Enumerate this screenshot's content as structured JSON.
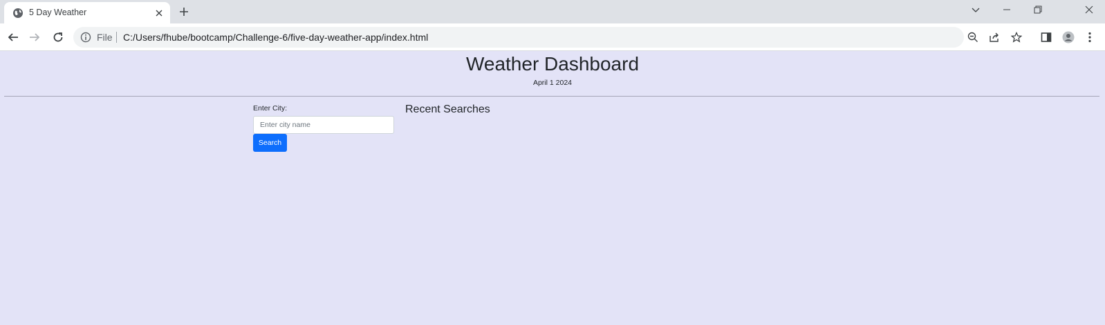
{
  "browser": {
    "tab": {
      "title": "5 Day Weather",
      "favicon_icon": "globe-icon"
    },
    "address_bar": {
      "scheme_label": "File",
      "url": "C:/Users/fhube/bootcamp/Challenge-6/five-day-weather-app/index.html"
    }
  },
  "page": {
    "title": "Weather Dashboard",
    "date": "April 1 2024",
    "search": {
      "label": "Enter City:",
      "placeholder": "Enter city name",
      "value": "",
      "button_label": "Search"
    },
    "recent": {
      "title": "Recent Searches",
      "items": []
    }
  },
  "colors": {
    "page_background": "#e3e3f7",
    "primary_button": "#0d6efd",
    "tabstrip": "#dee1e6"
  }
}
